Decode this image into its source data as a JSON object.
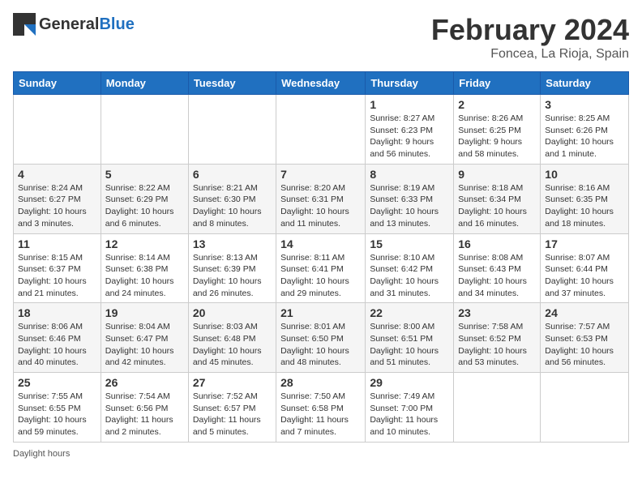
{
  "header": {
    "logo_general": "General",
    "logo_blue": "Blue",
    "title": "February 2024",
    "subtitle": "Foncea, La Rioja, Spain"
  },
  "weekdays": [
    "Sunday",
    "Monday",
    "Tuesday",
    "Wednesday",
    "Thursday",
    "Friday",
    "Saturday"
  ],
  "weeks": [
    [
      {
        "day": "",
        "info": ""
      },
      {
        "day": "",
        "info": ""
      },
      {
        "day": "",
        "info": ""
      },
      {
        "day": "",
        "info": ""
      },
      {
        "day": "1",
        "info": "Sunrise: 8:27 AM\nSunset: 6:23 PM\nDaylight: 9 hours and 56 minutes."
      },
      {
        "day": "2",
        "info": "Sunrise: 8:26 AM\nSunset: 6:25 PM\nDaylight: 9 hours and 58 minutes."
      },
      {
        "day": "3",
        "info": "Sunrise: 8:25 AM\nSunset: 6:26 PM\nDaylight: 10 hours and 1 minute."
      }
    ],
    [
      {
        "day": "4",
        "info": "Sunrise: 8:24 AM\nSunset: 6:27 PM\nDaylight: 10 hours and 3 minutes."
      },
      {
        "day": "5",
        "info": "Sunrise: 8:22 AM\nSunset: 6:29 PM\nDaylight: 10 hours and 6 minutes."
      },
      {
        "day": "6",
        "info": "Sunrise: 8:21 AM\nSunset: 6:30 PM\nDaylight: 10 hours and 8 minutes."
      },
      {
        "day": "7",
        "info": "Sunrise: 8:20 AM\nSunset: 6:31 PM\nDaylight: 10 hours and 11 minutes."
      },
      {
        "day": "8",
        "info": "Sunrise: 8:19 AM\nSunset: 6:33 PM\nDaylight: 10 hours and 13 minutes."
      },
      {
        "day": "9",
        "info": "Sunrise: 8:18 AM\nSunset: 6:34 PM\nDaylight: 10 hours and 16 minutes."
      },
      {
        "day": "10",
        "info": "Sunrise: 8:16 AM\nSunset: 6:35 PM\nDaylight: 10 hours and 18 minutes."
      }
    ],
    [
      {
        "day": "11",
        "info": "Sunrise: 8:15 AM\nSunset: 6:37 PM\nDaylight: 10 hours and 21 minutes."
      },
      {
        "day": "12",
        "info": "Sunrise: 8:14 AM\nSunset: 6:38 PM\nDaylight: 10 hours and 24 minutes."
      },
      {
        "day": "13",
        "info": "Sunrise: 8:13 AM\nSunset: 6:39 PM\nDaylight: 10 hours and 26 minutes."
      },
      {
        "day": "14",
        "info": "Sunrise: 8:11 AM\nSunset: 6:41 PM\nDaylight: 10 hours and 29 minutes."
      },
      {
        "day": "15",
        "info": "Sunrise: 8:10 AM\nSunset: 6:42 PM\nDaylight: 10 hours and 31 minutes."
      },
      {
        "day": "16",
        "info": "Sunrise: 8:08 AM\nSunset: 6:43 PM\nDaylight: 10 hours and 34 minutes."
      },
      {
        "day": "17",
        "info": "Sunrise: 8:07 AM\nSunset: 6:44 PM\nDaylight: 10 hours and 37 minutes."
      }
    ],
    [
      {
        "day": "18",
        "info": "Sunrise: 8:06 AM\nSunset: 6:46 PM\nDaylight: 10 hours and 40 minutes."
      },
      {
        "day": "19",
        "info": "Sunrise: 8:04 AM\nSunset: 6:47 PM\nDaylight: 10 hours and 42 minutes."
      },
      {
        "day": "20",
        "info": "Sunrise: 8:03 AM\nSunset: 6:48 PM\nDaylight: 10 hours and 45 minutes."
      },
      {
        "day": "21",
        "info": "Sunrise: 8:01 AM\nSunset: 6:50 PM\nDaylight: 10 hours and 48 minutes."
      },
      {
        "day": "22",
        "info": "Sunrise: 8:00 AM\nSunset: 6:51 PM\nDaylight: 10 hours and 51 minutes."
      },
      {
        "day": "23",
        "info": "Sunrise: 7:58 AM\nSunset: 6:52 PM\nDaylight: 10 hours and 53 minutes."
      },
      {
        "day": "24",
        "info": "Sunrise: 7:57 AM\nSunset: 6:53 PM\nDaylight: 10 hours and 56 minutes."
      }
    ],
    [
      {
        "day": "25",
        "info": "Sunrise: 7:55 AM\nSunset: 6:55 PM\nDaylight: 10 hours and 59 minutes."
      },
      {
        "day": "26",
        "info": "Sunrise: 7:54 AM\nSunset: 6:56 PM\nDaylight: 11 hours and 2 minutes."
      },
      {
        "day": "27",
        "info": "Sunrise: 7:52 AM\nSunset: 6:57 PM\nDaylight: 11 hours and 5 minutes."
      },
      {
        "day": "28",
        "info": "Sunrise: 7:50 AM\nSunset: 6:58 PM\nDaylight: 11 hours and 7 minutes."
      },
      {
        "day": "29",
        "info": "Sunrise: 7:49 AM\nSunset: 7:00 PM\nDaylight: 11 hours and 10 minutes."
      },
      {
        "day": "",
        "info": ""
      },
      {
        "day": "",
        "info": ""
      }
    ]
  ],
  "footer": {
    "daylight_label": "Daylight hours"
  }
}
